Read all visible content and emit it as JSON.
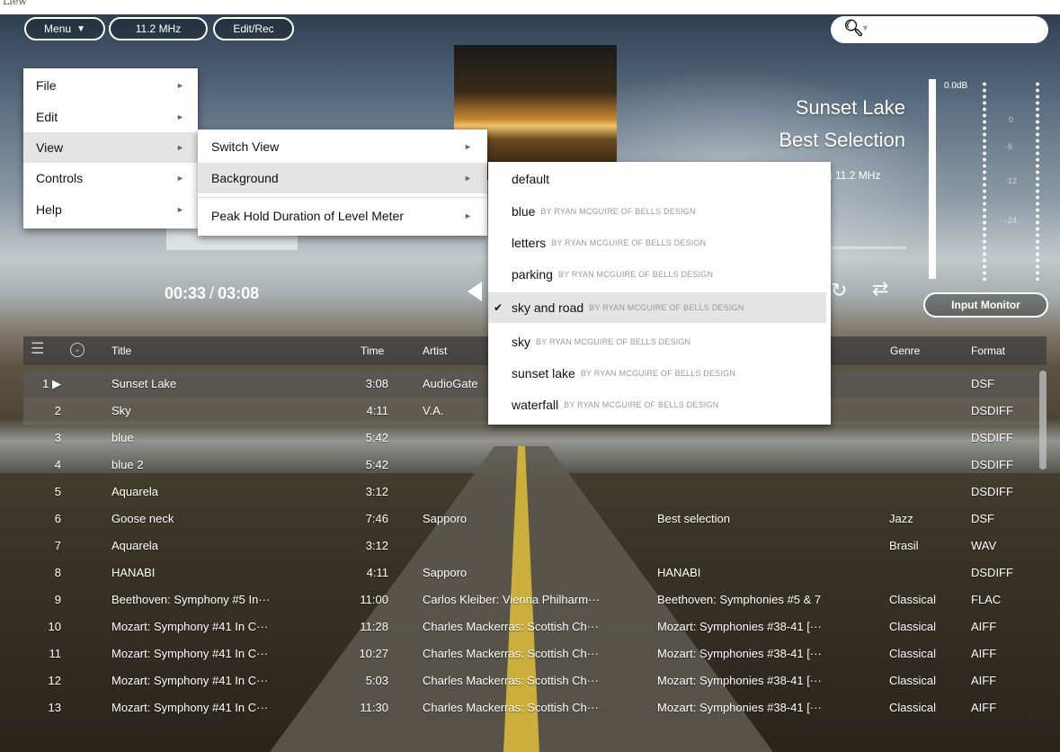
{
  "topstrip": {
    "text": "Liew"
  },
  "toolbar": {
    "menu_label": "Menu",
    "menu_arrow": "▼",
    "rate_label": "11.2 MHz",
    "edit_label": "Edit/Rec"
  },
  "search": {
    "icon": "search-icon",
    "dropdown": "▼"
  },
  "now_playing": {
    "title": "Sunset Lake",
    "album": "Best Selection",
    "format": "bit 11.2 MHz",
    "elapsed": "00:33",
    "separator": "/",
    "total": "03:08"
  },
  "meter": {
    "db_label": "0.0dB",
    "scale": [
      "0",
      "-6",
      "-12",
      "-24"
    ],
    "input_monitor": "Input Monitor"
  },
  "main_menu": {
    "items": [
      {
        "label": "File",
        "arrow": "►"
      },
      {
        "label": "Edit",
        "arrow": "►"
      },
      {
        "label": "View",
        "arrow": "►"
      },
      {
        "label": "Controls",
        "arrow": "►"
      },
      {
        "label": "Help",
        "arrow": "►"
      }
    ]
  },
  "view_menu": {
    "items": [
      {
        "label": "Switch View",
        "arrow": "►"
      },
      {
        "label": "Background",
        "arrow": "►"
      },
      {
        "label": "Peak Hold Duration of Level Meter",
        "arrow": "►"
      }
    ]
  },
  "background_menu": {
    "items": [
      {
        "label": "default",
        "credit": "",
        "checked": ""
      },
      {
        "label": "blue",
        "credit": "BY RYAN MCGUIRE OF BELLS DESIGN",
        "checked": ""
      },
      {
        "label": "letters",
        "credit": "BY RYAN MCGUIRE OF BELLS DESIGN",
        "checked": ""
      },
      {
        "label": "parking",
        "credit": "BY RYAN MCGUIRE OF BELLS DESIGN",
        "checked": ""
      },
      {
        "label": "sky and road",
        "credit": "BY RYAN MCGUIRE OF BELLS DESIGN",
        "checked": "✔"
      },
      {
        "label": "sky",
        "credit": "BY RYAN MCGUIRE OF BELLS DESIGN",
        "checked": ""
      },
      {
        "label": "sunset lake",
        "credit": "BY RYAN MCGUIRE OF BELLS DESIGN",
        "checked": ""
      },
      {
        "label": "waterfall",
        "credit": "BY RYAN MCGUIRE OF BELLS DESIGN",
        "checked": ""
      }
    ]
  },
  "table": {
    "headers": {
      "title": "Title",
      "time": "Time",
      "artist": "Artist",
      "genre": "Genre",
      "format": "Format"
    },
    "rows": [
      {
        "num": "1 ▶",
        "title": "Sunset Lake",
        "time": "3:08",
        "artist": "AudioGate",
        "album": "",
        "genre": "",
        "format": "DSF"
      },
      {
        "num": "2",
        "title": "Sky",
        "time": "4:11",
        "artist": "V.A.",
        "album": "",
        "genre": "",
        "format": "DSDIFF"
      },
      {
        "num": "3",
        "title": "blue",
        "time": "5:42",
        "artist": "",
        "album": "",
        "genre": "",
        "format": "DSDIFF"
      },
      {
        "num": "4",
        "title": "blue 2",
        "time": "5:42",
        "artist": "",
        "album": "",
        "genre": "",
        "format": "DSDIFF"
      },
      {
        "num": "5",
        "title": "Aquarela",
        "time": "3:12",
        "artist": "",
        "album": "",
        "genre": "",
        "format": "DSDIFF"
      },
      {
        "num": "6",
        "title": "Goose neck",
        "time": "7:46",
        "artist": "Sapporo",
        "album": "Best selection",
        "genre": "Jazz",
        "format": "DSF"
      },
      {
        "num": "7",
        "title": "Aquarela",
        "time": "3:12",
        "artist": "",
        "album": "",
        "genre": "Brasil",
        "format": "WAV"
      },
      {
        "num": "8",
        "title": "HANABI",
        "time": "4:11",
        "artist": "Sapporo",
        "album": "HANABI",
        "genre": "",
        "format": "DSDIFF"
      },
      {
        "num": "9",
        "title": "Beethoven: Symphony #5 In···",
        "time": "11:00",
        "artist": "Carlos Kleiber: Vienna Philharm···",
        "album": "Beethoven: Symphonies #5 & 7",
        "genre": "Classical",
        "format": "FLAC"
      },
      {
        "num": "10",
        "title": "Mozart: Symphony #41 In C···",
        "time": "11:28",
        "artist": "Charles Mackerras: Scottish Ch···",
        "album": "Mozart: Symphonies #38-41 [···",
        "genre": "Classical",
        "format": "AIFF"
      },
      {
        "num": "11",
        "title": "Mozart: Symphony #41 In C···",
        "time": "10:27",
        "artist": "Charles Mackerras: Scottish Ch···",
        "album": "Mozart: Symphonies #38-41 [···",
        "genre": "Classical",
        "format": "AIFF"
      },
      {
        "num": "12",
        "title": "Mozart: Symphony #41 In C···",
        "time": "5:03",
        "artist": "Charles Mackerras: Scottish Ch···",
        "album": "Mozart: Symphonies #38-41 [···",
        "genre": "Classical",
        "format": "AIFF"
      },
      {
        "num": "13",
        "title": "Mozart: Symphony #41 In C···",
        "time": "11:30",
        "artist": "Charles Mackerras: Scottish Ch···",
        "album": "Mozart: Symphonies #38-41 [···",
        "genre": "Classical",
        "format": "AIFF"
      }
    ]
  }
}
